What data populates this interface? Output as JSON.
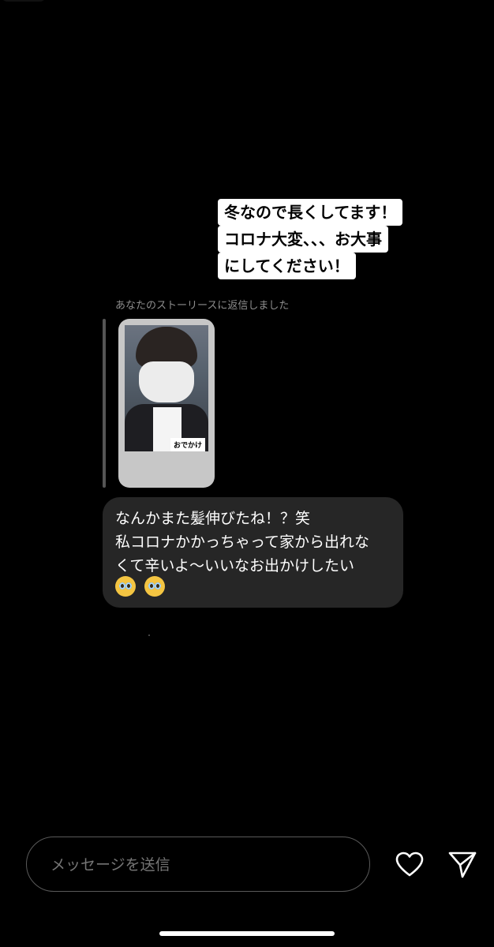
{
  "story_sticker": {
    "line1": "冬なので長くしてます！",
    "line2": "コロナ大変、、、お大事",
    "line3": "にしてください！"
  },
  "reply": {
    "label": "あなたのストーリースに返信しました",
    "story_tag": "おでかけ"
  },
  "message": {
    "line1": "なんかまた髪伸びたね！？笑",
    "line2": "私コロナかかっちゃって家から出れな",
    "line3": "くて辛いよ〜いいなお出かけしたい",
    "emojis": [
      "pleading-face-icon",
      "pleading-face-icon"
    ]
  },
  "composer": {
    "placeholder": "メッセージを送信"
  },
  "colors": {
    "background": "#000000",
    "bubble": "#262626",
    "sticker_bg": "#ffffff",
    "muted_text": "#8e8e8e"
  }
}
